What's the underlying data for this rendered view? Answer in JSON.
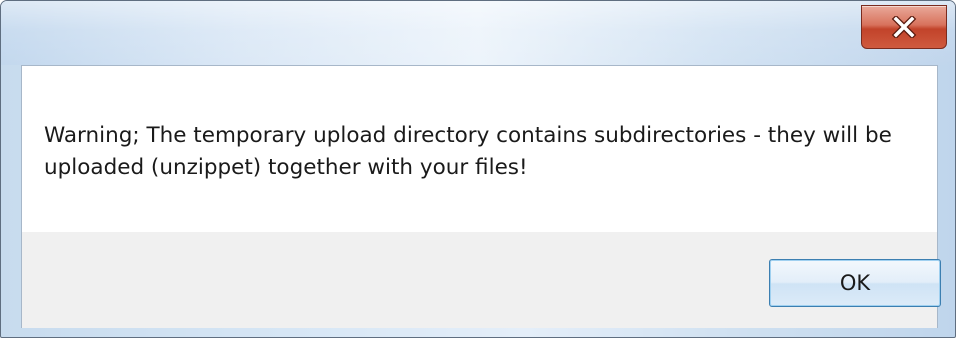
{
  "window": {
    "title": "",
    "close_icon": "close-x-icon"
  },
  "message": {
    "text": "Warning; The temporary upload directory contains subdirectories - they will be uploaded (unzippet) together with your files!"
  },
  "buttons": {
    "ok_label": "OK"
  },
  "colors": {
    "close_button": "#c94a30",
    "ok_button_border": "#3c7fb1",
    "button_bar": "#f0f0f0"
  }
}
